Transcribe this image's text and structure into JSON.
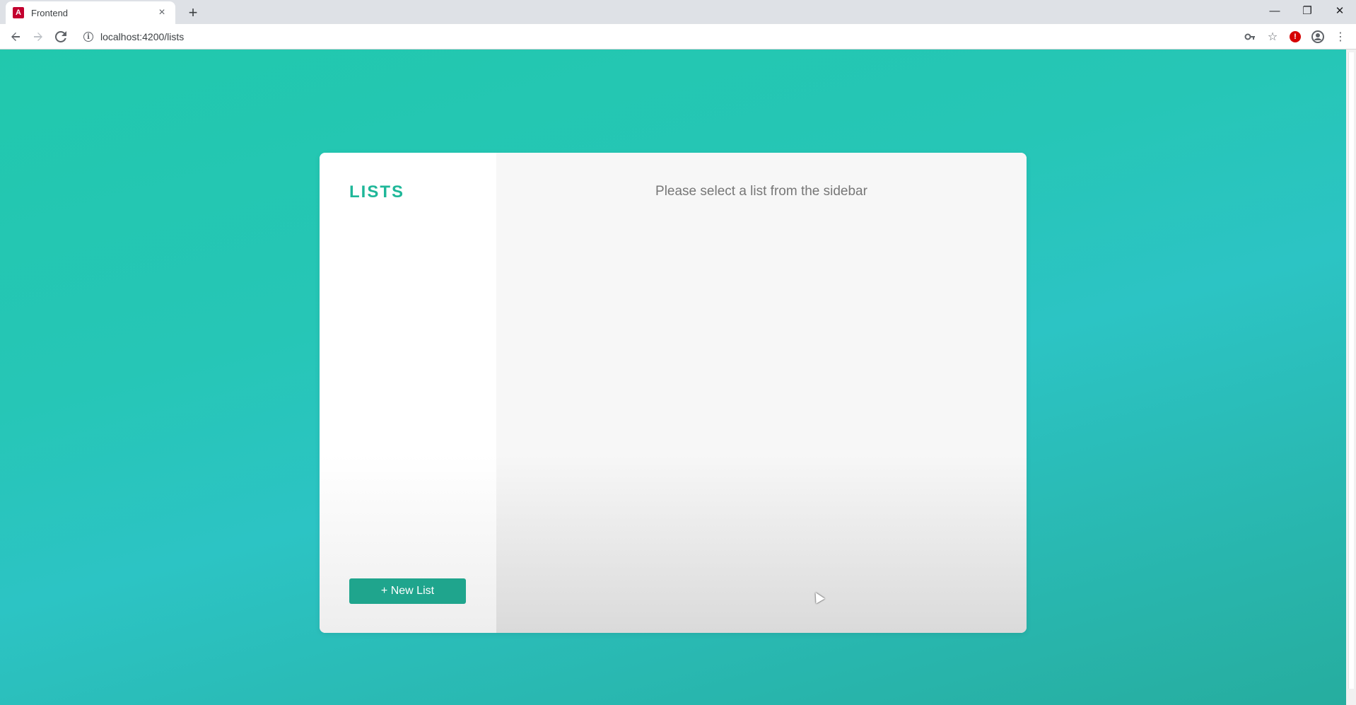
{
  "browser": {
    "tab": {
      "title": "Frontend",
      "favicon": "angular-icon"
    },
    "new_tab_label": "+",
    "window_controls": [
      "minimize",
      "restore",
      "close"
    ],
    "url": "localhost:4200/lists"
  },
  "sidebar": {
    "title": "LISTS",
    "new_list_button": "+ New List"
  },
  "main": {
    "empty_message": "Please select a list from the sidebar"
  },
  "colors": {
    "accent": "#1fb799",
    "button": "#1fa58d",
    "background_gradient": [
      "#21c8ad",
      "#2cc4c4",
      "#26ad9f"
    ]
  }
}
